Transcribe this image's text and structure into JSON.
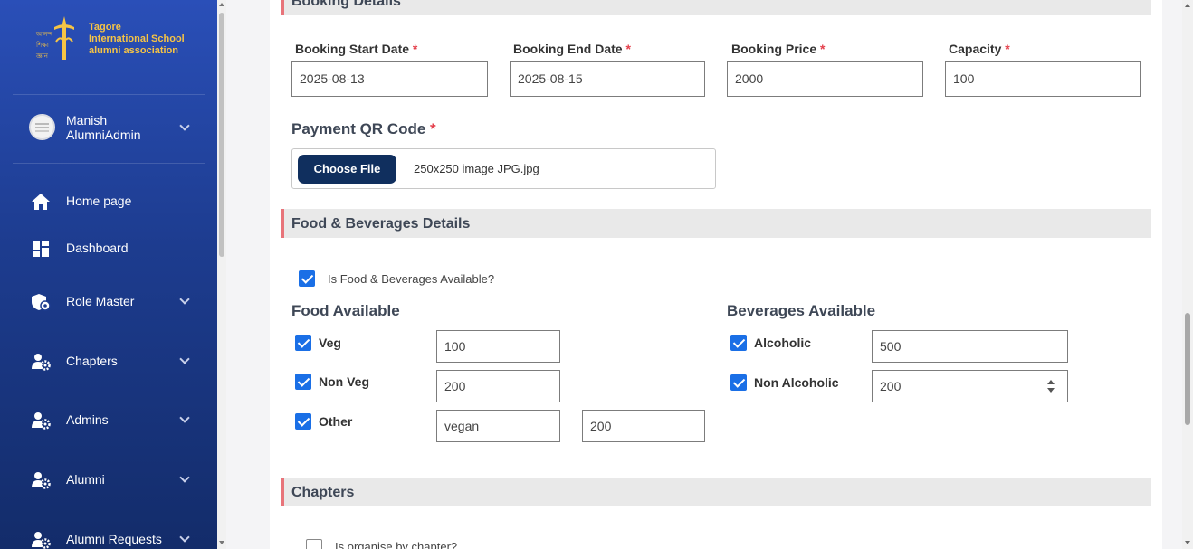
{
  "brand": {
    "line1": "Tagore",
    "line2": "International School",
    "line3": "alumni association"
  },
  "user": {
    "first": "Manish",
    "second": "AlumniAdmin"
  },
  "nav": [
    {
      "label": "Home page",
      "icon": "home-icon"
    },
    {
      "label": "Dashboard",
      "icon": "dashboard-icon"
    },
    {
      "label": "Role Master",
      "icon": "role-shield-icon"
    },
    {
      "label": "Chapters",
      "icon": "user-gear-icon"
    },
    {
      "label": "Admins",
      "icon": "user-gear-icon"
    },
    {
      "label": "Alumni",
      "icon": "user-gear-icon"
    },
    {
      "label": "Alumni Requests",
      "icon": "user-gear-icon"
    }
  ],
  "booking": {
    "section_title": "Booking Details",
    "start_label": "Booking Start Date",
    "start_value": "2025-08-13",
    "end_label": "Booking End Date",
    "end_value": "2025-08-15",
    "price_label": "Booking Price",
    "price_value": "2000",
    "capacity_label": "Capacity",
    "capacity_value": "100",
    "required_mark": "*"
  },
  "payment": {
    "label": "Payment QR Code",
    "button": "Choose File",
    "file_name": "250x250 image JPG.jpg"
  },
  "food_bev": {
    "section_title": "Food & Beverages Details",
    "available_label": "Is Food & Beverages Available?",
    "food_title": "Food Available",
    "bev_title": "Beverages Available",
    "veg_label": "Veg",
    "veg_value": "100",
    "nonveg_label": "Non Veg",
    "nonveg_value": "200",
    "other_label": "Other",
    "other_name": "vegan",
    "other_value": "200",
    "alcoholic_label": "Alcoholic",
    "alcoholic_value": "500",
    "nonalcoholic_label": "Non Alcoholic",
    "nonalcoholic_value": "200"
  },
  "chapters": {
    "section_title": "Chapters",
    "organise_label": "Is organise by chapter?"
  },
  "colors": {
    "sidebar_top": "#2a4fb8",
    "sidebar_bottom": "#132c6a",
    "accent_bar": "#e8747a",
    "checkbox": "#1a6fe6",
    "file_button": "#102f5e",
    "logo": "#f6c445"
  }
}
